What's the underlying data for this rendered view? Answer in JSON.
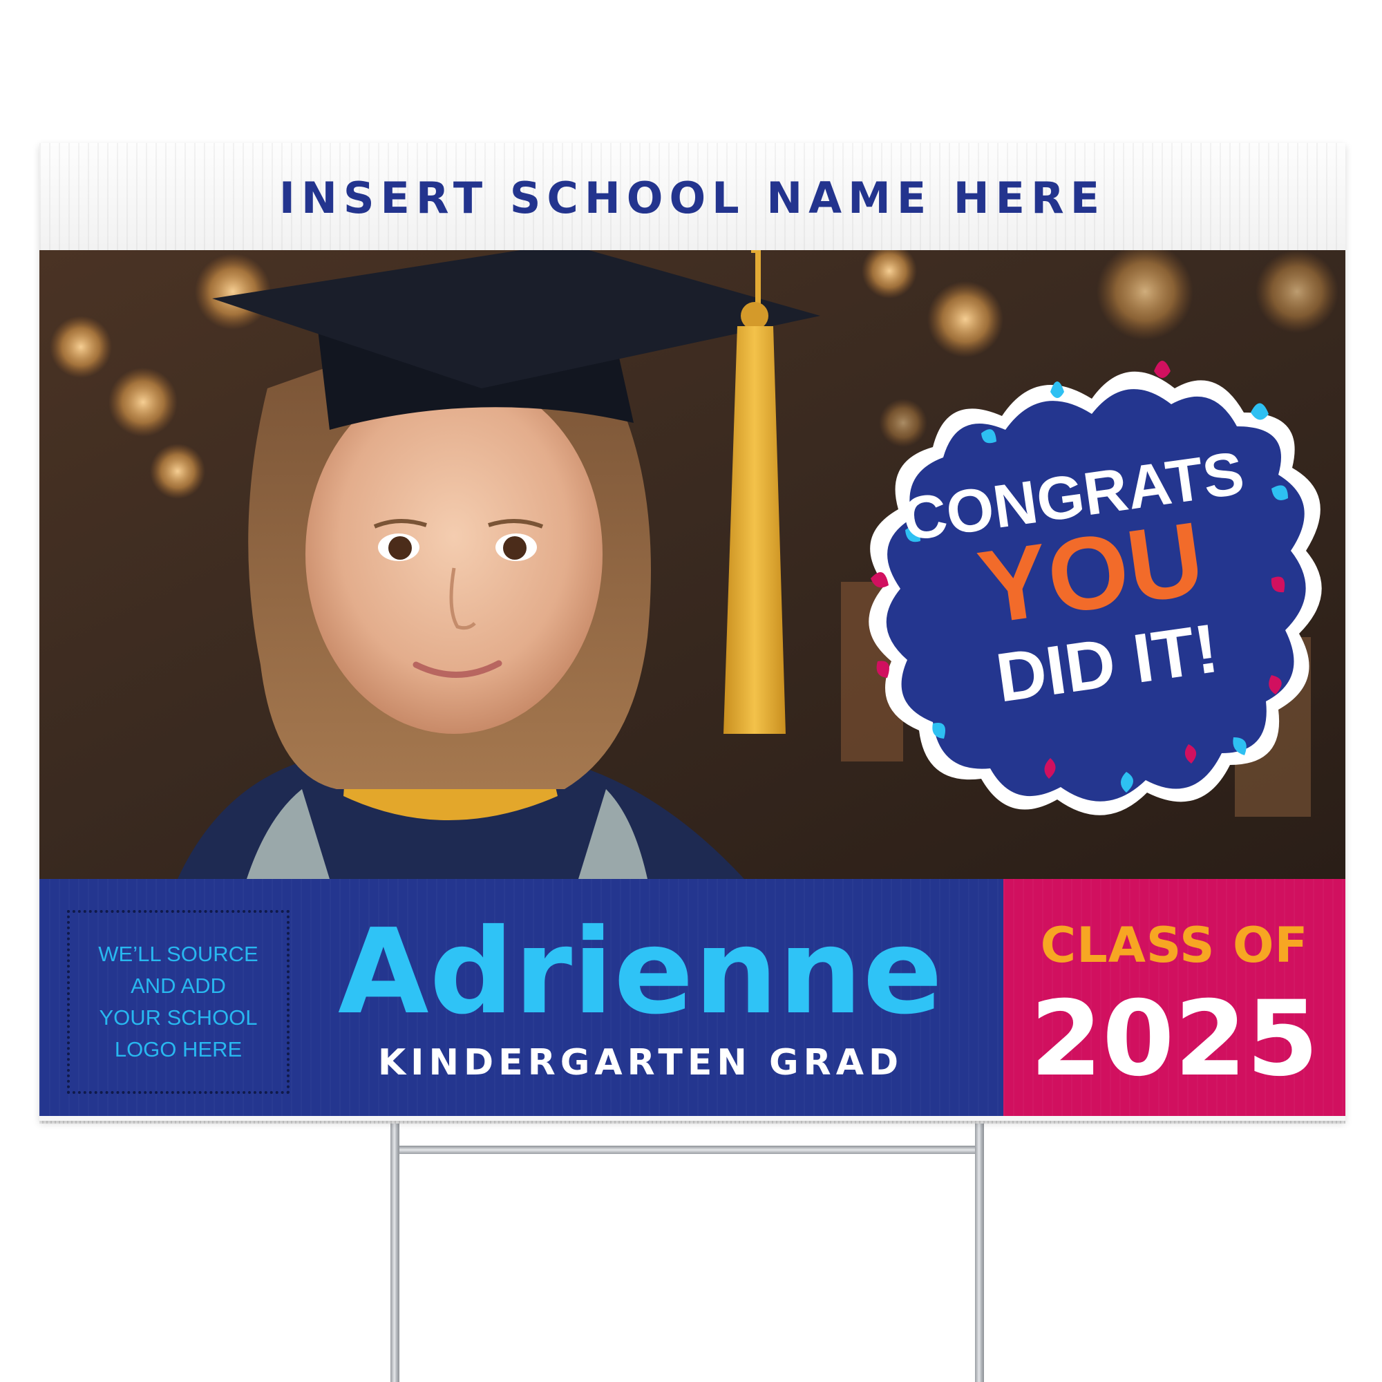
{
  "header": {
    "school_name": "INSERT SCHOOL NAME HERE"
  },
  "photo": {
    "subject": "photo-of-graduate"
  },
  "badge": {
    "line1": "CONGRATS",
    "line2": "YOU",
    "line3": "DID IT!"
  },
  "logo_placeholder": {
    "lines": [
      "WE’LL SOURCE",
      "AND ADD",
      "YOUR SCHOOL",
      "LOGO HERE"
    ]
  },
  "graduate": {
    "name": "Adrienne",
    "subtitle": "KINDERGARTEN GRAD"
  },
  "class": {
    "label": "CLASS OF",
    "year": "2025"
  },
  "colors": {
    "navy": "#24368f",
    "magenta": "#d1105f",
    "cyan": "#2fc3f6",
    "orange": "#f26b2a",
    "gold": "#f7a623"
  }
}
